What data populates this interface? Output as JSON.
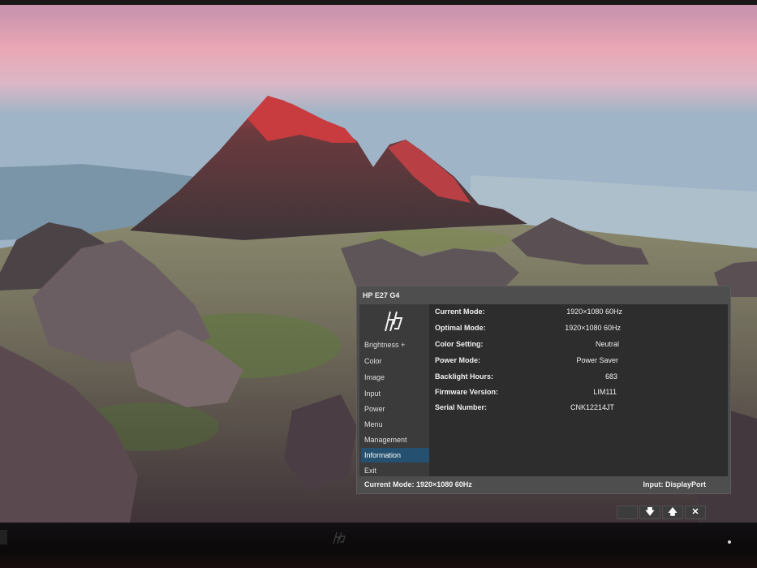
{
  "osd": {
    "title": "HP E27 G4",
    "logo": "hp-logo",
    "menu": [
      {
        "label": "Brightness +",
        "selected": false
      },
      {
        "label": "Color",
        "selected": false
      },
      {
        "label": "Image",
        "selected": false
      },
      {
        "label": "Input",
        "selected": false
      },
      {
        "label": "Power",
        "selected": false
      },
      {
        "label": "Menu",
        "selected": false
      },
      {
        "label": "Management",
        "selected": false
      },
      {
        "label": "Information",
        "selected": true
      },
      {
        "label": "Exit",
        "selected": false
      }
    ],
    "info": [
      {
        "label": "Current Mode:",
        "value": "1920×1080  60Hz"
      },
      {
        "label": "Optimal Mode:",
        "value": "1920×1080  60Hz"
      },
      {
        "label": "Color Setting:",
        "value": "Neutral"
      },
      {
        "label": "Power Mode:",
        "value": "Power Saver"
      },
      {
        "label": "Backlight Hours:",
        "value": "683"
      },
      {
        "label": "Firmware Version:",
        "value": "LIM111"
      },
      {
        "label": "Serial Number:",
        "value": "CNK12214JT"
      }
    ],
    "status": {
      "left": "Current Mode: 1920×1080  60Hz",
      "right": "Input: DisplayPort"
    },
    "keys": [
      {
        "icon": "blank-key",
        "glyph": ""
      },
      {
        "icon": "arrow-down-icon",
        "glyph": "🡇"
      },
      {
        "icon": "arrow-up-icon",
        "glyph": "🡅"
      },
      {
        "icon": "close-icon",
        "glyph": "✕"
      }
    ]
  },
  "colors": {
    "osd_panel": "#2d2d2d",
    "osd_sidebar": "#3b3b3b",
    "osd_selected": "#25506f"
  }
}
